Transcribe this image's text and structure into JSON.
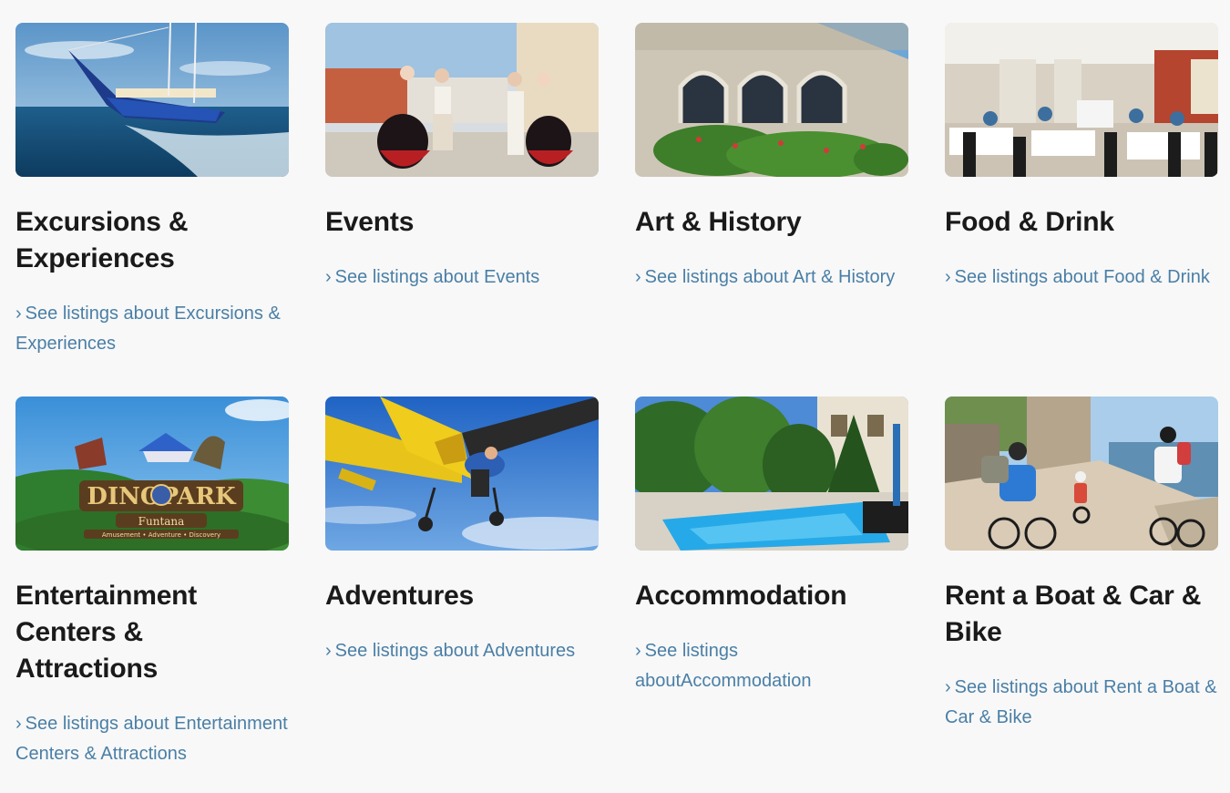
{
  "cards": [
    {
      "image_icon": "sailboat-photo",
      "title": "Excursions & Experiences",
      "link_label": "See listings about Excursions & Experiences"
    },
    {
      "image_icon": "folk-dance-photo",
      "title": "Events",
      "link_label": "See listings about Events"
    },
    {
      "image_icon": "stone-window-photo",
      "title": "Art & History",
      "link_label": "See listings about Art & History"
    },
    {
      "image_icon": "restaurant-terrace-photo",
      "title": "Food & Drink",
      "link_label": "See listings about Food & Drink"
    },
    {
      "image_icon": "dinopark-photo",
      "title": "Entertainment Centers & Attractions",
      "link_label": "See listings about Entertainment Centers & Attractions",
      "image_logo_text": "DINOPARK",
      "image_logo_subtext": "Funtana",
      "image_logo_tagline": "Amusement • Adventure • Discovery"
    },
    {
      "image_icon": "skydiving-photo",
      "title": "Adventures",
      "link_label": "See listings about Adventures"
    },
    {
      "image_icon": "pool-photo",
      "title": "Accommodation",
      "link_label": "See listings aboutAccommodation"
    },
    {
      "image_icon": "cycling-photo",
      "title": "Rent a Boat & Car & Bike",
      "link_label": "See listings about Rent a Boat & Car & Bike"
    }
  ],
  "link_chevron": "›",
  "colors": {
    "background": "#f8f8f8",
    "title": "#1a1a1a",
    "link": "#4a7fa6"
  }
}
